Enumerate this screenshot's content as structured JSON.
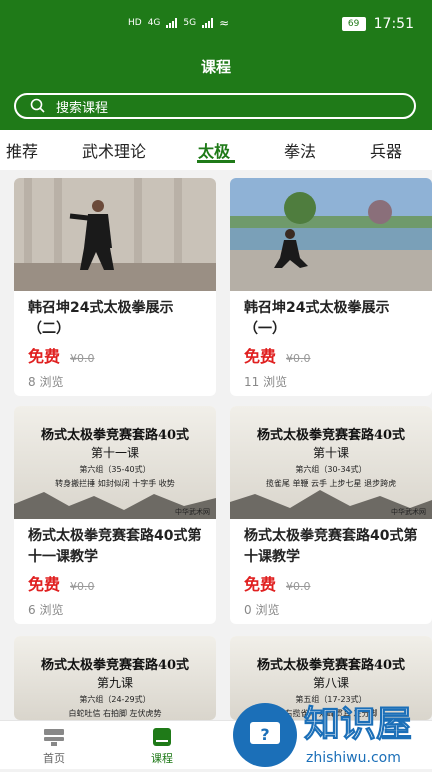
{
  "status_bar": {
    "network": "HD",
    "signal1": "4G",
    "signal2": "5G",
    "battery": "69",
    "time": "17:51"
  },
  "header": {
    "title": "课程"
  },
  "search": {
    "placeholder": "搜索课程"
  },
  "tabs": [
    {
      "label": "推荐"
    },
    {
      "label": "武术理论"
    },
    {
      "label": "太极"
    },
    {
      "label": "拳法"
    },
    {
      "label": "兵器"
    }
  ],
  "courses": [
    {
      "title": "韩召坤24式太极拳展示（二）",
      "price": "免费",
      "original_price": "¥0.0",
      "views": "8 浏览"
    },
    {
      "title": "韩召坤24式太极拳展示（一）",
      "price": "免费",
      "original_price": "¥0.0",
      "views": "11 浏览"
    },
    {
      "title": "杨式太极拳竞赛套路40式第十一课教学",
      "price": "免费",
      "original_price": "¥0.0",
      "views": "6 浏览",
      "poster_title": "杨式太极拳竞赛套路40式",
      "poster_sub": "第十一课",
      "poster_line": "第六组（35-40式）",
      "poster_moves": "转身搬拦捶 如封似闭 十字手 收势",
      "poster_org": "中华武术网"
    },
    {
      "title": "杨式太极拳竞赛套路40式第十课教学",
      "price": "免费",
      "original_price": "¥0.0",
      "views": "0 浏览",
      "poster_title": "杨式太极拳竞赛套路40式",
      "poster_sub": "第十课",
      "poster_line": "第六组（30-34式）",
      "poster_moves": "揽雀尾 单鞭 云手 上步七星 退步跨虎",
      "poster_org": "中华武术网"
    },
    {
      "poster_title": "杨式太极拳竞赛套路40式",
      "poster_sub": "第九课",
      "poster_line": "第六组（24-29式）",
      "poster_moves": "白蛇吐信 右拍脚 左伏虎势"
    },
    {
      "poster_title": "杨式太极拳竞赛套路40式",
      "poster_sub": "第八课",
      "poster_line": "第五组（17-23式）",
      "poster_moves": "右揽雀尾 双峰贯耳 左分脚"
    }
  ],
  "bottom_nav": [
    {
      "label": "首页"
    },
    {
      "label": "课程"
    }
  ],
  "watermark": {
    "brand": "知识屋",
    "domain": "zhishiwu.com"
  },
  "colors": {
    "brand_green": "#1f7a18",
    "price_red": "#e02020"
  }
}
